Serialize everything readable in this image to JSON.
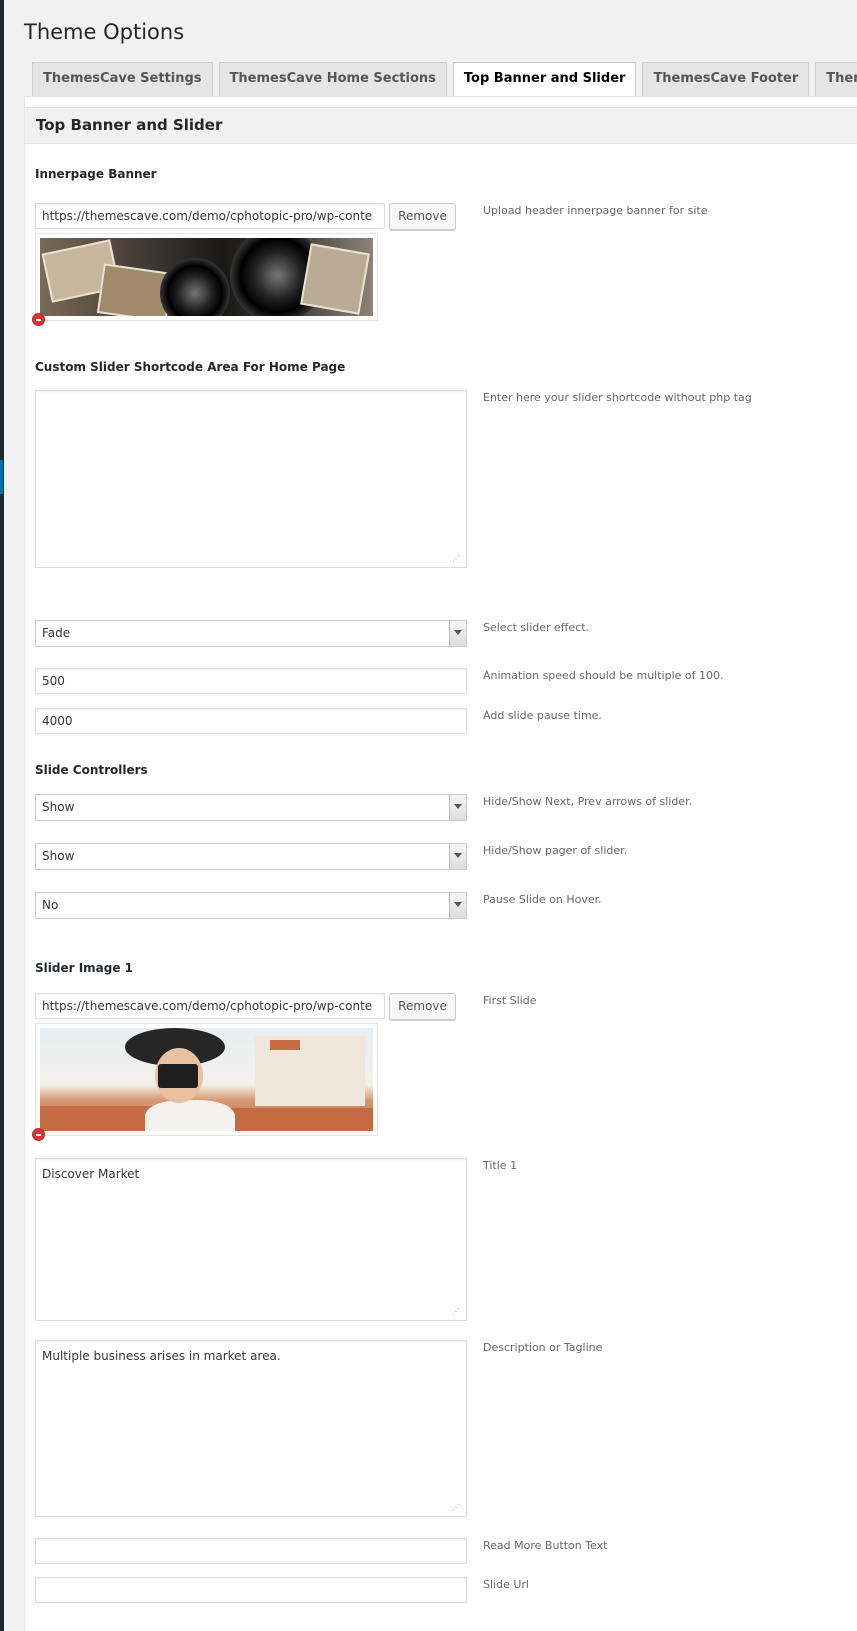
{
  "page": {
    "title": "Theme Options"
  },
  "tabs": [
    {
      "label": "ThemesCave Settings",
      "active": false
    },
    {
      "label": "ThemesCave Home Sections",
      "active": false
    },
    {
      "label": "Top Banner and Slider",
      "active": true
    },
    {
      "label": "ThemesCave Footer",
      "active": false
    },
    {
      "label": "ThemesCave Short Co",
      "active": false
    }
  ],
  "panel": {
    "title": "Top Banner and Slider"
  },
  "innerpage_banner": {
    "label": "Innerpage Banner",
    "url": "https://themescave.com/demo/cphotopic-pro/wp-conte",
    "remove_label": "Remove",
    "desc": "Upload header innerpage banner for site"
  },
  "custom_slider": {
    "label": "Custom Slider Shortcode Area For Home Page",
    "value": "",
    "desc": "Enter here your slider shortcode without php tag"
  },
  "slider_settings": {
    "effect": {
      "value": "Fade",
      "desc": "Select slider effect."
    },
    "speed": {
      "value": "500",
      "desc": "Animation speed should be multiple of 100."
    },
    "pause": {
      "value": "4000",
      "desc": "Add slide pause time."
    }
  },
  "slide_controllers": {
    "label": "Slide Controllers",
    "arrows": {
      "value": "Show",
      "desc": "Hide/Show Next, Prev arrows of slider."
    },
    "pager": {
      "value": "Show",
      "desc": "Hide/Show pager of slider."
    },
    "hover": {
      "value": "No",
      "desc": "Pause Slide on Hover."
    }
  },
  "slider_image_1": {
    "label": "Slider Image 1",
    "url": "https://themescave.com/demo/cphotopic-pro/wp-conte",
    "remove_label": "Remove",
    "desc": "First Slide",
    "title_value": "Discover Market",
    "title_desc": "Title 1",
    "tagline_value": "Multiple business arises in market area.",
    "tagline_desc": "Description or Tagline",
    "readmore_value": "",
    "readmore_desc": "Read More Button Text",
    "url_value": "",
    "url_desc": "Slide Url"
  },
  "icons": {
    "remove": "remove-circle-icon",
    "dropdown": "chevron-down-icon",
    "resize": "resize-grip-icon"
  }
}
